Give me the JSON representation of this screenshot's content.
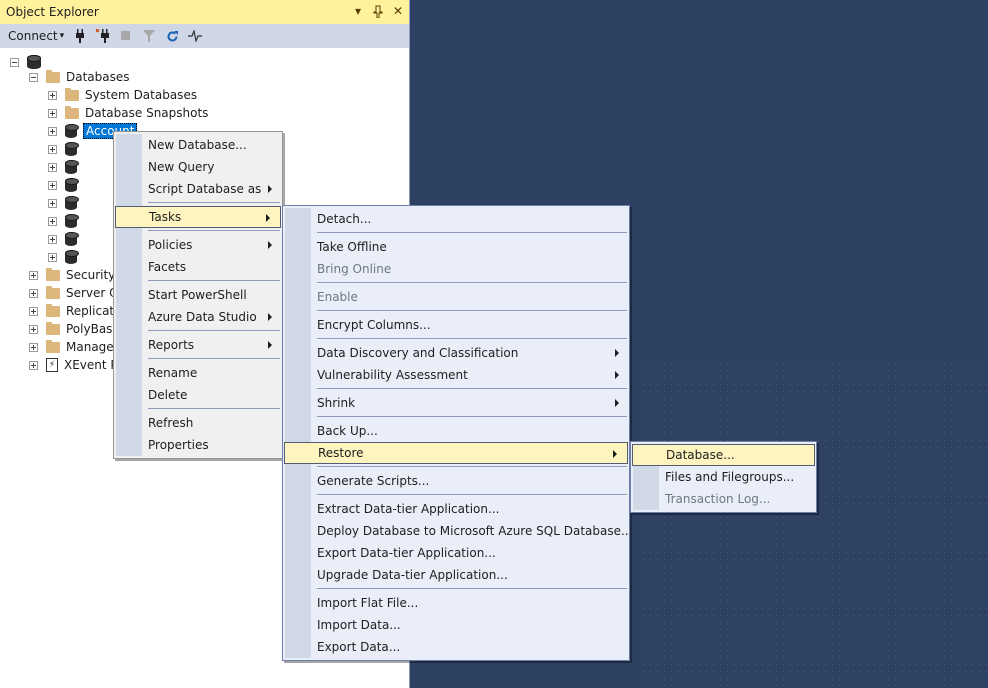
{
  "panel": {
    "title": "Object Explorer",
    "title_buttons": [
      "dropdown",
      "pin",
      "close"
    ],
    "toolbar": {
      "connect_label": "Connect",
      "icons": [
        "connect-plug-icon",
        "disconnect-plug-icon",
        "stop-icon",
        "filter-icon",
        "refresh-icon",
        "activity-monitor-icon"
      ]
    }
  },
  "tree": {
    "server_label": "",
    "databases_label": "Databases",
    "system_databases": "System Databases",
    "database_snapshots": "Database Snapshots",
    "selected_db": "Account",
    "other_dbs_count": 7,
    "nodes": [
      "Security",
      "Server Ob",
      "Replicati",
      "PolyBase",
      "Managem",
      "XEvent P"
    ]
  },
  "context_menu": {
    "items": [
      {
        "label": "New Database...",
        "submenu": false
      },
      {
        "label": "New Query",
        "submenu": false
      },
      {
        "label": "Script Database as",
        "submenu": true
      },
      {
        "sep": true
      },
      {
        "label": "Tasks",
        "submenu": true,
        "highlight": true
      },
      {
        "sep": true
      },
      {
        "label": "Policies",
        "submenu": true
      },
      {
        "label": "Facets",
        "submenu": false
      },
      {
        "sep": true
      },
      {
        "label": "Start PowerShell",
        "submenu": false
      },
      {
        "label": "Azure Data Studio",
        "submenu": true
      },
      {
        "sep": true
      },
      {
        "label": "Reports",
        "submenu": true
      },
      {
        "sep": true
      },
      {
        "label": "Rename",
        "submenu": false
      },
      {
        "label": "Delete",
        "submenu": false
      },
      {
        "sep": true
      },
      {
        "label": "Refresh",
        "submenu": false
      },
      {
        "label": "Properties",
        "submenu": false
      }
    ]
  },
  "tasks_menu": {
    "items": [
      {
        "label": "Detach..."
      },
      {
        "sep": true
      },
      {
        "label": "Take Offline"
      },
      {
        "label": "Bring Online",
        "disabled": true
      },
      {
        "sep": true
      },
      {
        "label": "Enable",
        "disabled": true
      },
      {
        "sep": true
      },
      {
        "label": "Encrypt Columns..."
      },
      {
        "sep": true
      },
      {
        "label": "Data Discovery and Classification",
        "submenu": true
      },
      {
        "label": "Vulnerability Assessment",
        "submenu": true
      },
      {
        "sep": true
      },
      {
        "label": "Shrink",
        "submenu": true
      },
      {
        "sep": true
      },
      {
        "label": "Back Up..."
      },
      {
        "label": "Restore",
        "submenu": true,
        "highlight": true
      },
      {
        "sep": true
      },
      {
        "label": "Generate Scripts..."
      },
      {
        "sep": true
      },
      {
        "label": "Extract Data-tier Application..."
      },
      {
        "label": "Deploy Database to Microsoft Azure SQL Database..."
      },
      {
        "label": "Export Data-tier Application..."
      },
      {
        "label": "Upgrade Data-tier Application..."
      },
      {
        "sep": true
      },
      {
        "label": "Import Flat File..."
      },
      {
        "label": "Import Data..."
      },
      {
        "label": "Export Data..."
      }
    ]
  },
  "restore_menu": {
    "items": [
      {
        "label": "Database...",
        "highlight": true
      },
      {
        "label": "Files and Filegroups..."
      },
      {
        "label": "Transaction Log...",
        "disabled": true
      }
    ]
  },
  "colors": {
    "title_bar": "#fff29d",
    "toolbar": "#cfd6e5",
    "highlight": "#fdf4bf",
    "selection": "#0078d7",
    "background": "#2f4163"
  }
}
